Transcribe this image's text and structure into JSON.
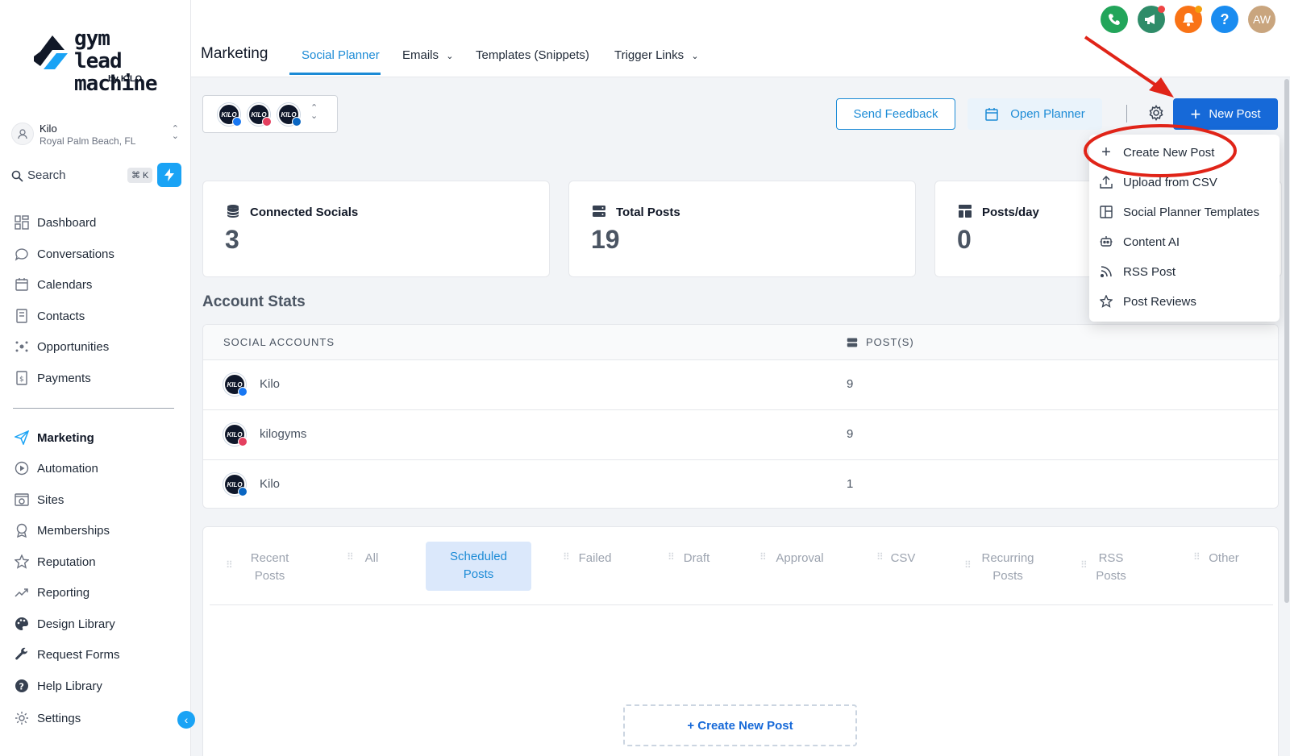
{
  "logo": {
    "line1": "gym lead",
    "line2": "machine",
    "by": "by KILO"
  },
  "location": {
    "name": "Kilo",
    "address": "Royal Palm Beach, FL"
  },
  "search": {
    "label": "Search",
    "shortcut": "⌘ K"
  },
  "sidebar": {
    "items": [
      {
        "label": "Dashboard"
      },
      {
        "label": "Conversations"
      },
      {
        "label": "Calendars"
      },
      {
        "label": "Contacts"
      },
      {
        "label": "Opportunities"
      },
      {
        "label": "Payments"
      },
      {
        "label": "Marketing"
      },
      {
        "label": "Automation"
      },
      {
        "label": "Sites"
      },
      {
        "label": "Memberships"
      },
      {
        "label": "Reputation"
      },
      {
        "label": "Reporting"
      },
      {
        "label": "Design Library"
      },
      {
        "label": "Request Forms"
      },
      {
        "label": "Help Library"
      },
      {
        "label": "Settings"
      }
    ]
  },
  "header": {
    "title": "Marketing",
    "tabs": [
      {
        "label": "Social Planner"
      },
      {
        "label": "Emails"
      },
      {
        "label": "Templates (Snippets)"
      },
      {
        "label": "Trigger Links"
      }
    ],
    "avatar_initials": "AW",
    "help_glyph": "?"
  },
  "accounts_avatar_text": "KILO",
  "toolbar": {
    "feedback": "Send Feedback",
    "planner": "Open Planner",
    "new_post": "New Post"
  },
  "stats": [
    {
      "label": "Connected Socials",
      "value": "3"
    },
    {
      "label": "Total Posts",
      "value": "19"
    },
    {
      "label": "Posts/day",
      "value": "0"
    }
  ],
  "account_stats": {
    "title": "Account Stats",
    "col_accounts": "SOCIAL ACCOUNTS",
    "col_posts": "POST(S)",
    "rows": [
      {
        "name": "Kilo",
        "network": "facebook",
        "posts": "9"
      },
      {
        "name": "kilogyms",
        "network": "instagram",
        "posts": "9"
      },
      {
        "name": "Kilo",
        "network": "linkedin",
        "posts": "1"
      }
    ]
  },
  "post_tabs": [
    {
      "line1": "Recent",
      "line2": "Posts"
    },
    {
      "line1": "All",
      "line2": ""
    },
    {
      "line1": "Scheduled",
      "line2": "Posts"
    },
    {
      "line1": "Failed",
      "line2": ""
    },
    {
      "line1": "Draft",
      "line2": ""
    },
    {
      "line1": "Approval",
      "line2": ""
    },
    {
      "line1": "CSV",
      "line2": ""
    },
    {
      "line1": "Recurring",
      "line2": "Posts"
    },
    {
      "line1": "RSS",
      "line2": "Posts"
    },
    {
      "line1": "Other",
      "line2": ""
    }
  ],
  "create_new_post": "+ Create New Post",
  "dropdown": {
    "items": [
      {
        "label": "Create New Post"
      },
      {
        "label": "Upload from CSV"
      },
      {
        "label": "Social Planner Templates"
      },
      {
        "label": "Content AI"
      },
      {
        "label": "RSS Post"
      },
      {
        "label": "Post Reviews"
      }
    ]
  },
  "colors": {
    "accent": "#1c8bd6",
    "primary_button": "#1669d8",
    "annotation_red": "#e02418",
    "sidebar_bolt": "#1aa3f5"
  }
}
